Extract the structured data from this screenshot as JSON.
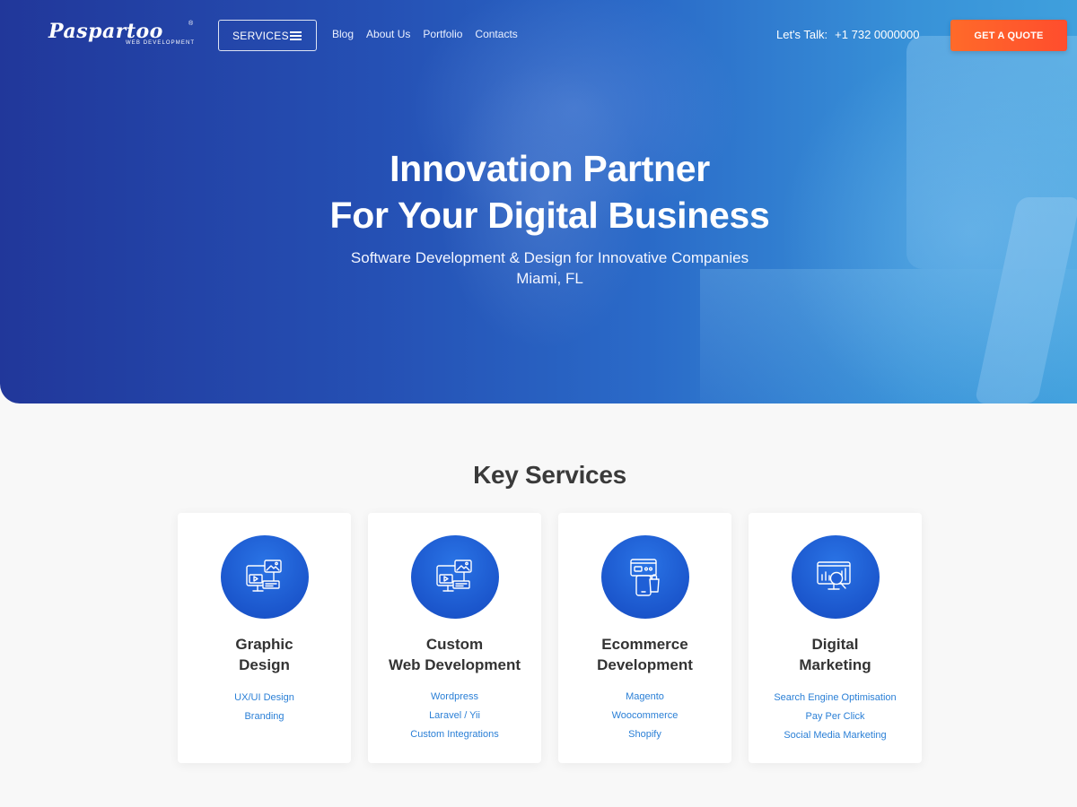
{
  "header": {
    "logo_text": "Paspartoo",
    "logo_sub": "WEB DEVELOPMENT",
    "logo_reg": "®",
    "services_label": "SERVICES",
    "nav": [
      "Blog",
      "About Us",
      "Portfolio",
      "Contacts"
    ],
    "talk_label": "Let's Talk:",
    "phone": "+1 732 0000000",
    "quote_label": "GET A QUOTE"
  },
  "hero": {
    "title_line1": "Innovation Partner",
    "title_line2": "For Your Digital Business",
    "subtitle_line1": "Software Development & Design for Innovative Companies",
    "subtitle_line2": "Miami, FL"
  },
  "services": {
    "title": "Key Services",
    "cards": [
      {
        "icon": "design-screen-icon",
        "title_line1": "Graphic",
        "title_line2": "Design",
        "links": [
          "UX/UI Design",
          "Branding"
        ]
      },
      {
        "icon": "web-dev-screen-icon",
        "title_line1": "Custom",
        "title_line2": "Web Development",
        "links": [
          "Wordpress",
          "Laravel / Yii",
          "Custom Integrations"
        ]
      },
      {
        "icon": "ecommerce-icon",
        "title_line1": "Ecommerce",
        "title_line2": "Development",
        "links": [
          "Magento",
          "Woocommerce",
          "Shopify"
        ]
      },
      {
        "icon": "marketing-analytics-icon",
        "title_line1": "Digital",
        "title_line2": "Marketing",
        "links": [
          "Search Engine Optimisation",
          "Pay Per Click",
          "Social Media Marketing"
        ]
      }
    ]
  },
  "colors": {
    "hero_left": "#21379a",
    "hero_right": "#3fa0dd",
    "accent_orange": "#ff5a2c",
    "icon_blue": "#1b56cc",
    "link_blue": "#2a7fd6",
    "page_bg": "#f8f8f8"
  }
}
